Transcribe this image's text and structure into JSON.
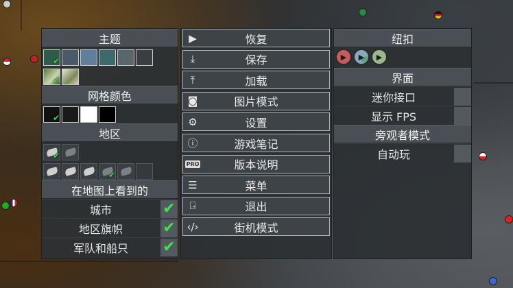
{
  "theme": {
    "title": "主题",
    "swatch_colors": [
      "#2f5c4a",
      "#4a5a66",
      "#5f7f9a",
      "#3f6a6c",
      "#5a666a",
      "#3a3e42"
    ],
    "images": [
      "forest-theme-image",
      "snow-theme-image"
    ]
  },
  "grid_color": {
    "title": "网格颜色",
    "colors": [
      "#111111",
      "#1a1a1a",
      "#ffffff",
      "#000000"
    ]
  },
  "region": {
    "title": "地区"
  },
  "map_visible": {
    "title": "在地图上看到的",
    "items": [
      {
        "label": "城市",
        "checked": true
      },
      {
        "label": "地区旗帜",
        "checked": true
      },
      {
        "label": "军队和船只",
        "checked": true
      }
    ]
  },
  "menu": {
    "items": [
      {
        "label": "恢复",
        "icon": "play-icon"
      },
      {
        "label": "保存",
        "icon": "download-icon"
      },
      {
        "label": "加载",
        "icon": "upload-icon"
      },
      {
        "label": "图片模式",
        "icon": "camera-icon"
      },
      {
        "label": "设置",
        "icon": "gear-icon"
      },
      {
        "label": "游戏笔记",
        "icon": "info-icon"
      },
      {
        "label": "版本说明",
        "icon": "pro-badge-icon"
      },
      {
        "label": "菜单",
        "icon": "hamburger-icon"
      },
      {
        "label": "退出",
        "icon": "exit-door-icon"
      },
      {
        "label": "街机模式",
        "icon": "code-icon"
      }
    ],
    "pro_badge": "PRO"
  },
  "right": {
    "buttons_title": "纽扣",
    "interface_title": "界面",
    "interface_items": [
      {
        "label": "迷你接口",
        "checked": false
      },
      {
        "label": "显示 FPS",
        "checked": false
      }
    ],
    "spectator_title": "旁观者模式",
    "spectator_items": [
      {
        "label": "自动玩",
        "checked": false
      }
    ]
  },
  "colors": {
    "check": "#3ae04a",
    "panel": "#2c3034",
    "header": "#4a4f55"
  }
}
